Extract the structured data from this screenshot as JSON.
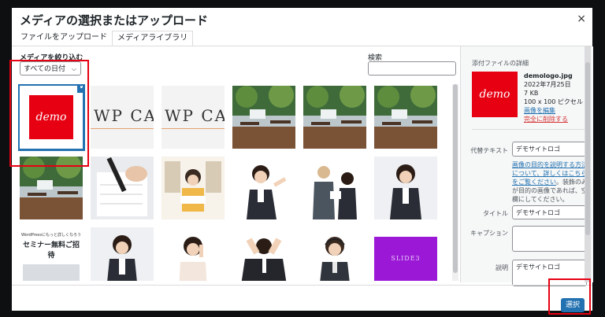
{
  "modal": {
    "title": "メディアの選択またはアップロード",
    "close": "×",
    "tabs": [
      "ファイルをアップロード",
      "メディアライブラリ"
    ]
  },
  "filter": {
    "label": "メディアを絞り込む",
    "date_value": "すべての日付",
    "search_label": "検索"
  },
  "grid": {
    "items": [
      {
        "type": "demo-logo",
        "text": "demo",
        "selected": true
      },
      {
        "type": "wp-text",
        "text": "WP CA"
      },
      {
        "type": "wp-text",
        "text": "WP CA"
      },
      {
        "type": "photo",
        "subject": "cafe-interior"
      },
      {
        "type": "photo",
        "subject": "cafe-interior"
      },
      {
        "type": "photo",
        "subject": "cafe-interior"
      },
      {
        "type": "photo",
        "subject": "cafe-interior"
      },
      {
        "type": "photo",
        "subject": "hand-writing"
      },
      {
        "type": "photo",
        "subject": "woman-reading"
      },
      {
        "type": "photo",
        "subject": "businesswoman-pointing"
      },
      {
        "type": "photo",
        "subject": "business-people"
      },
      {
        "type": "photo",
        "subject": "businesswoman"
      },
      {
        "type": "banner",
        "lines": [
          "WordPressにもっと詳しくなろう",
          "セミナー無料ご招待"
        ]
      },
      {
        "type": "photo",
        "subject": "businesswoman"
      },
      {
        "type": "photo",
        "subject": "woman-thinking"
      },
      {
        "type": "photo",
        "subject": "stressed-man"
      },
      {
        "type": "photo",
        "subject": "woman-headset"
      },
      {
        "type": "slide",
        "text": "SLIDE3"
      }
    ]
  },
  "details": {
    "heading": "添付ファイルの詳細",
    "thumb_text": "demo",
    "filename": "demologo.jpg",
    "date": "2022年7月25日",
    "size": "7 KB",
    "dimensions": "100 x 100 ピクセル",
    "edit_link": "画像を編集",
    "delete_link": "完全に削除する",
    "alt_label": "代替テキスト",
    "alt_value": "デモサイトロゴ",
    "help_link": "画像の目的を説明する方法について、詳しくはこちらをご覧ください",
    "help_text": "。装飾のみが目的の画像であれば、空欄にしてください。",
    "title_label": "タイトル",
    "title_value": "デモサイトロゴ",
    "caption_label": "キャプション",
    "caption_value": "",
    "desc_label": "説明",
    "desc_value": "デモサイトロゴ"
  },
  "footer": {
    "select_button": "選択"
  },
  "colors": {
    "accent": "#2271b1",
    "highlight": "#e60012",
    "danger": "#d63638"
  }
}
